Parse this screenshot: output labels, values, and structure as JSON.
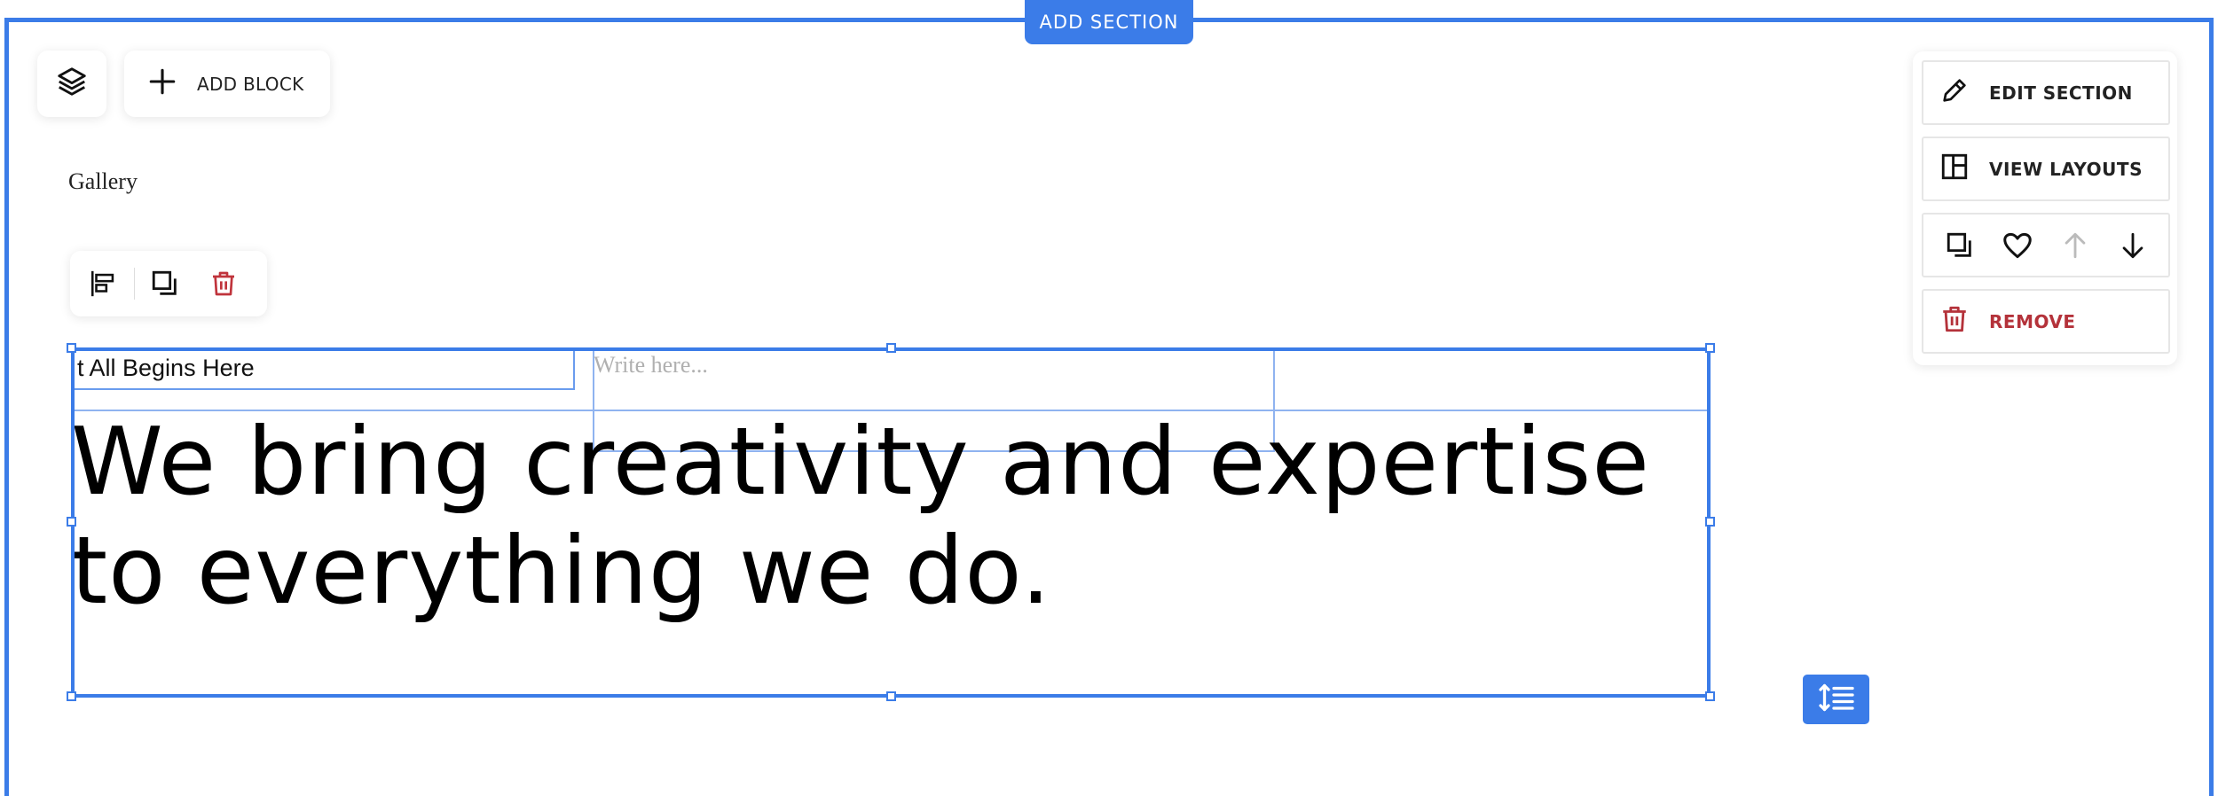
{
  "top_bar": {
    "add_section_label": "ADD SECTION"
  },
  "toolbar": {
    "layers_icon": "layers-icon",
    "add_block_label": "ADD BLOCK"
  },
  "section": {
    "title": "Gallery",
    "tag_text": "t All Begins Here",
    "placeholder_text": "Write here...",
    "headline_line1": "We bring creativity and expertise",
    "headline_line2": "to everything we do."
  },
  "block_toolbar": {
    "icons": [
      "align-left-icon",
      "duplicate-icon",
      "trash-icon"
    ]
  },
  "section_panel": {
    "edit_label": "EDIT SECTION",
    "layouts_label": "VIEW LAYOUTS",
    "remove_label": "REMOVE",
    "icons": [
      "duplicate-icon",
      "heart-icon",
      "arrow-up-icon",
      "arrow-down-icon"
    ]
  },
  "colors": {
    "accent": "#3b7ce8",
    "danger": "#b4323a",
    "disabled": "#bbbbbb"
  }
}
